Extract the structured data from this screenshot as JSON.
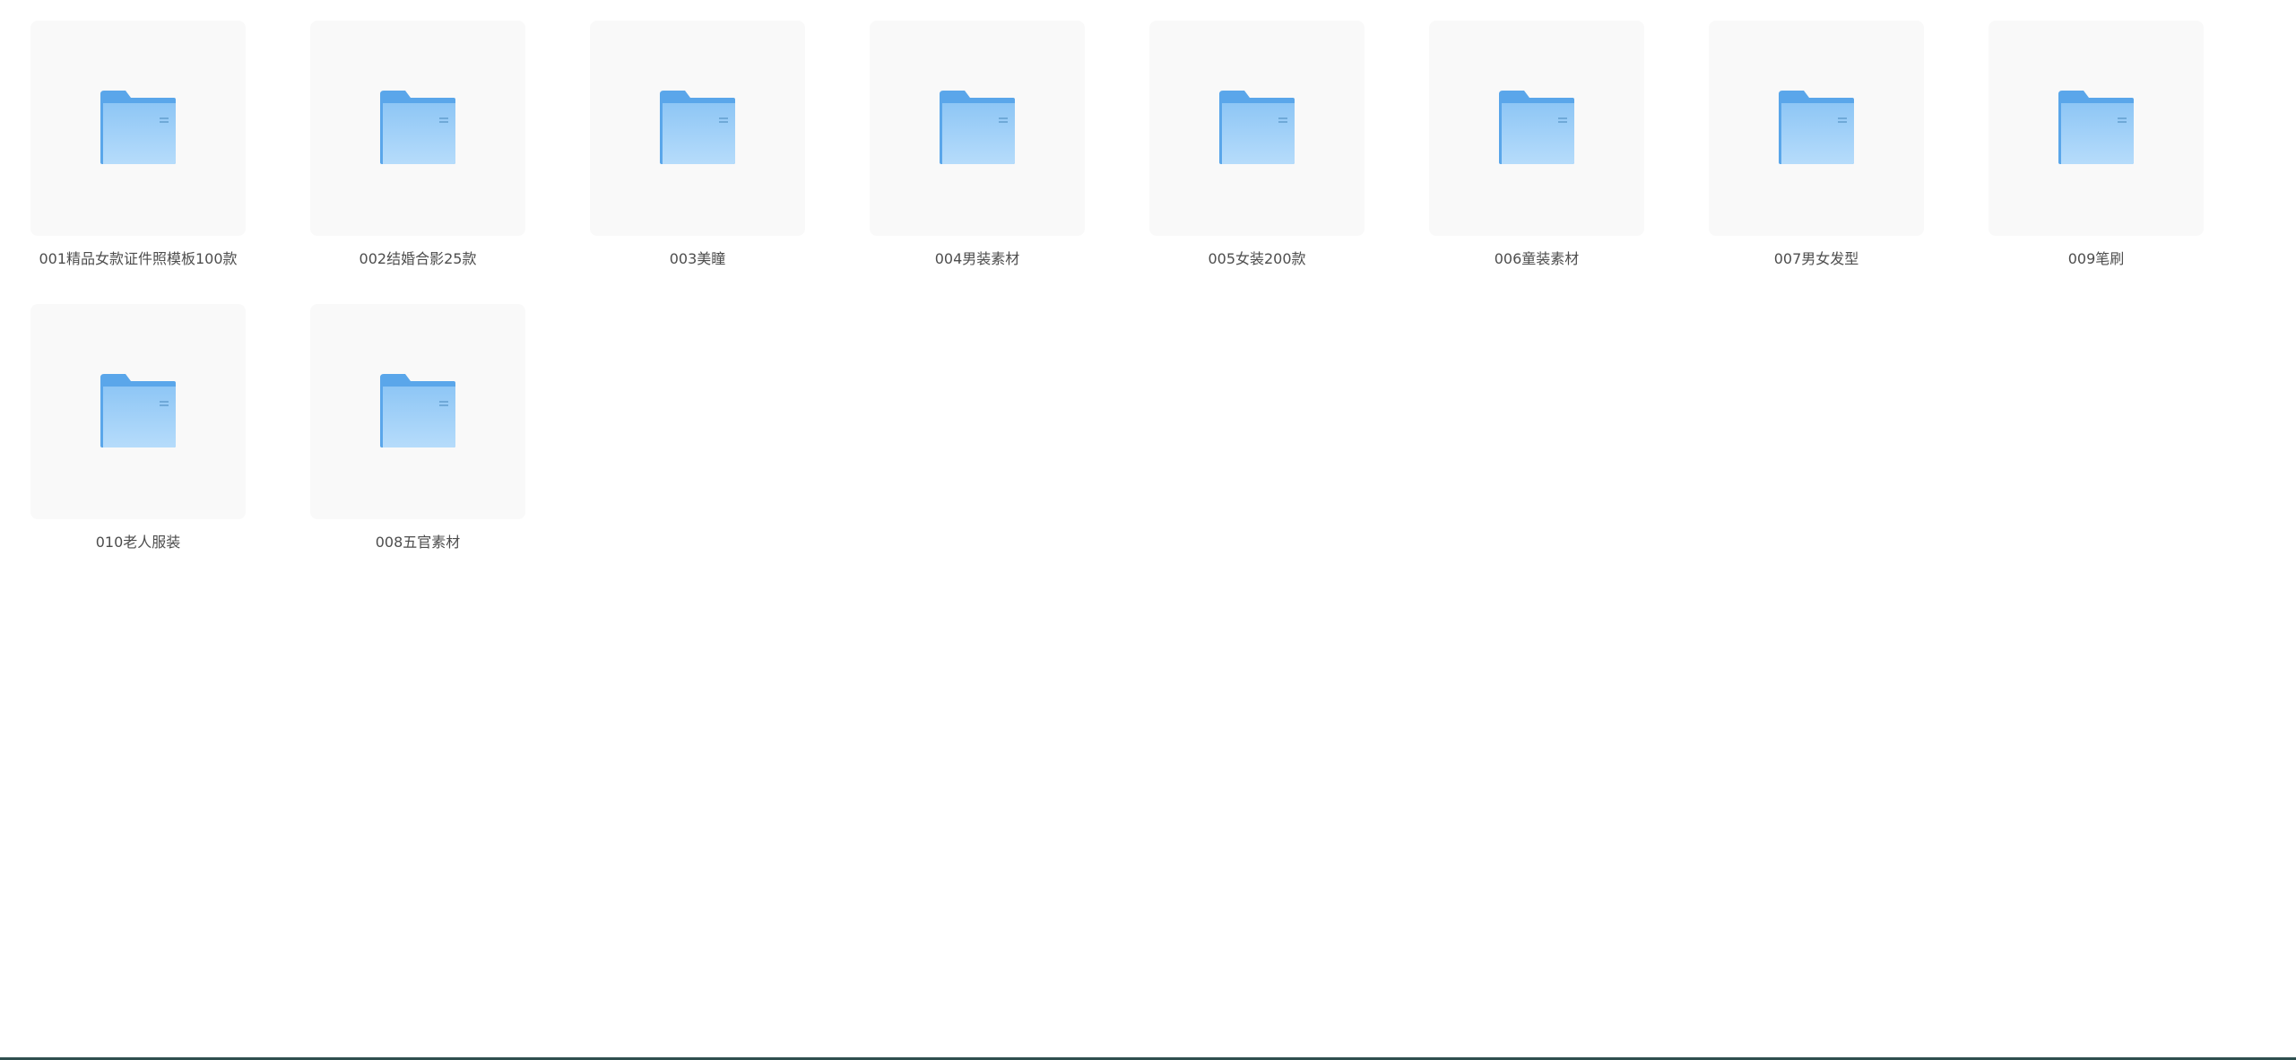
{
  "folders": [
    {
      "name": "001精品女款证件照模板100款",
      "icon": "folder-icon"
    },
    {
      "name": "002结婚合影25款",
      "icon": "folder-icon"
    },
    {
      "name": "003美瞳",
      "icon": "folder-icon"
    },
    {
      "name": "004男装素材",
      "icon": "folder-icon"
    },
    {
      "name": "005女装200款",
      "icon": "folder-icon"
    },
    {
      "name": "006童装素材",
      "icon": "folder-icon"
    },
    {
      "name": "007男女发型",
      "icon": "folder-icon"
    },
    {
      "name": "009笔刷",
      "icon": "folder-icon"
    },
    {
      "name": "010老人服装",
      "icon": "folder-icon"
    },
    {
      "name": "008五官素材",
      "icon": "folder-icon"
    }
  ],
  "colors": {
    "folder_back": "#5aa6ea",
    "folder_front_top": "#8ec6f5",
    "folder_front_bottom": "#b6dcfb",
    "tile_bg": "#f9f9f9",
    "label_text": "#4d4d4d"
  }
}
